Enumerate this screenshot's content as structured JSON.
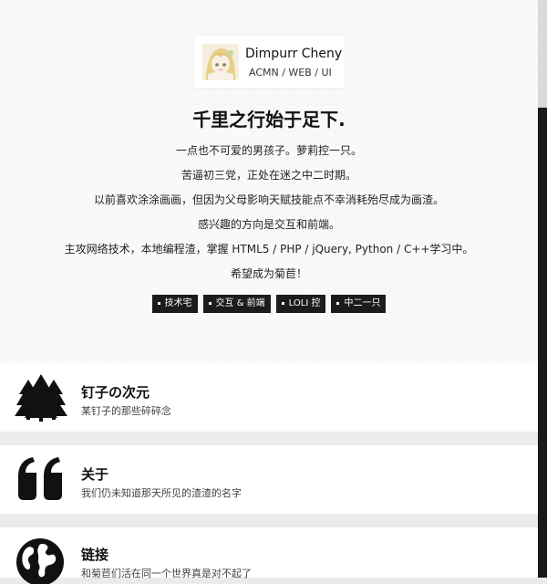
{
  "profile": {
    "name": "Dimpurr Cheny",
    "role": "ACMN / WEB / UI"
  },
  "headline": "千里之行始于足下.",
  "bio": [
    "一点也不可爱的男孩子。萝莉控一只。",
    "苦逼初三党，正处在迷之中二时期。",
    "以前喜欢涂涂画画，但因为父母影响天赋技能点不幸消耗殆尽成为画渣。",
    "感兴趣的方向是交互和前端。",
    "主攻网络技术，本地编程渣，掌握 HTML5 / PHP / jQuery, Python / C++学习中。",
    "希望成为菊苣！"
  ],
  "tags": [
    "技术宅",
    "交互 & 前端",
    "LOLI 控",
    "中二一只"
  ],
  "sections": [
    {
      "icon": "trees-icon",
      "title": "钉子の次元",
      "subtitle": "某钉子的那些碎碎念"
    },
    {
      "icon": "quote-icon",
      "title": "关于",
      "subtitle": "我们仍未知道那天所见的渣渣的名字"
    },
    {
      "icon": "globe-icon",
      "title": "链接",
      "subtitle": "和菊苣们活在同一个世界真是对不起了"
    }
  ]
}
